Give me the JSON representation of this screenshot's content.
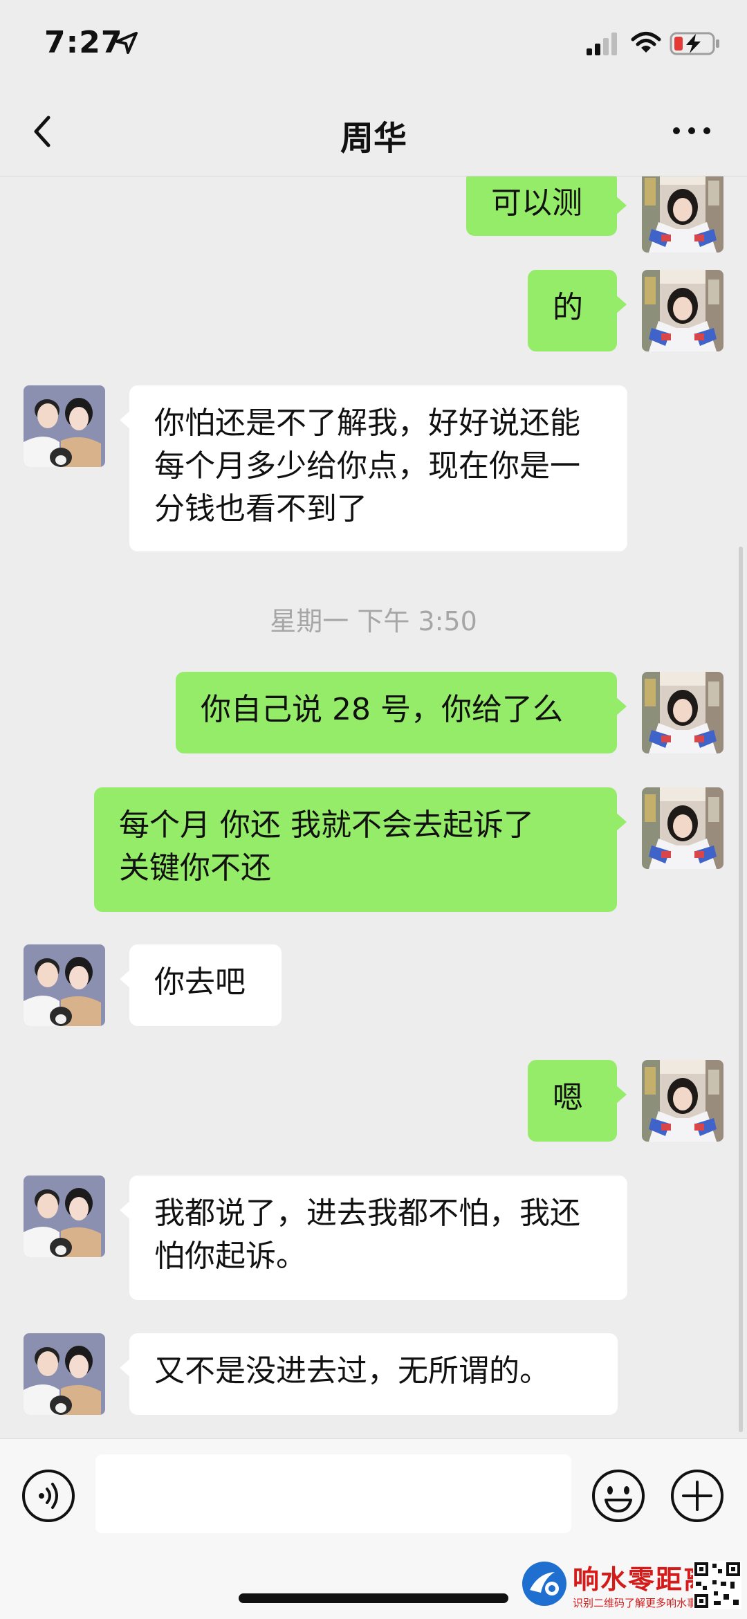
{
  "status_bar": {
    "time": "7:27",
    "icons": [
      "location-arrow-icon",
      "cellular-signal-icon",
      "wifi-icon",
      "battery-low-charging-icon"
    ]
  },
  "nav": {
    "title": "周华",
    "back_icon": "chevron-left-icon",
    "more_icon": "more-dots-icon"
  },
  "messages": [
    {
      "side": "right",
      "text": "可以测"
    },
    {
      "side": "right",
      "text": "的"
    },
    {
      "side": "left",
      "text": "你怕还是不了解我，好好说还能每个月多少给你点，现在你是一分钱也看不到了"
    },
    {
      "type": "timestamp",
      "text": "星期一 下午 3:50"
    },
    {
      "side": "right",
      "text": "你自己说 28 号，你给了么"
    },
    {
      "side": "right",
      "text": "每个月 你还 我就不会去起诉了\n关键你不还"
    },
    {
      "side": "left",
      "text": "你去吧"
    },
    {
      "side": "right",
      "text": "嗯"
    },
    {
      "side": "left",
      "text": "我都说了，进去我都不怕，我还怕你起诉。"
    },
    {
      "side": "left",
      "text": "又不是没进去过，无所谓的。"
    }
  ],
  "input_bar": {
    "placeholder": "",
    "icons": [
      "voice-icon",
      "emoji-icon",
      "plus-icon"
    ]
  },
  "watermark": {
    "title": "响水零距离",
    "subtitle": "识别二维码了解更多响水事"
  },
  "colors": {
    "background": "#ededed",
    "sent_bubble": "#95ec69",
    "received_bubble": "#ffffff",
    "timestamp_text": "#a6a6a6",
    "battery_low": "#e53935",
    "watermark_red": "#d51a1a"
  }
}
